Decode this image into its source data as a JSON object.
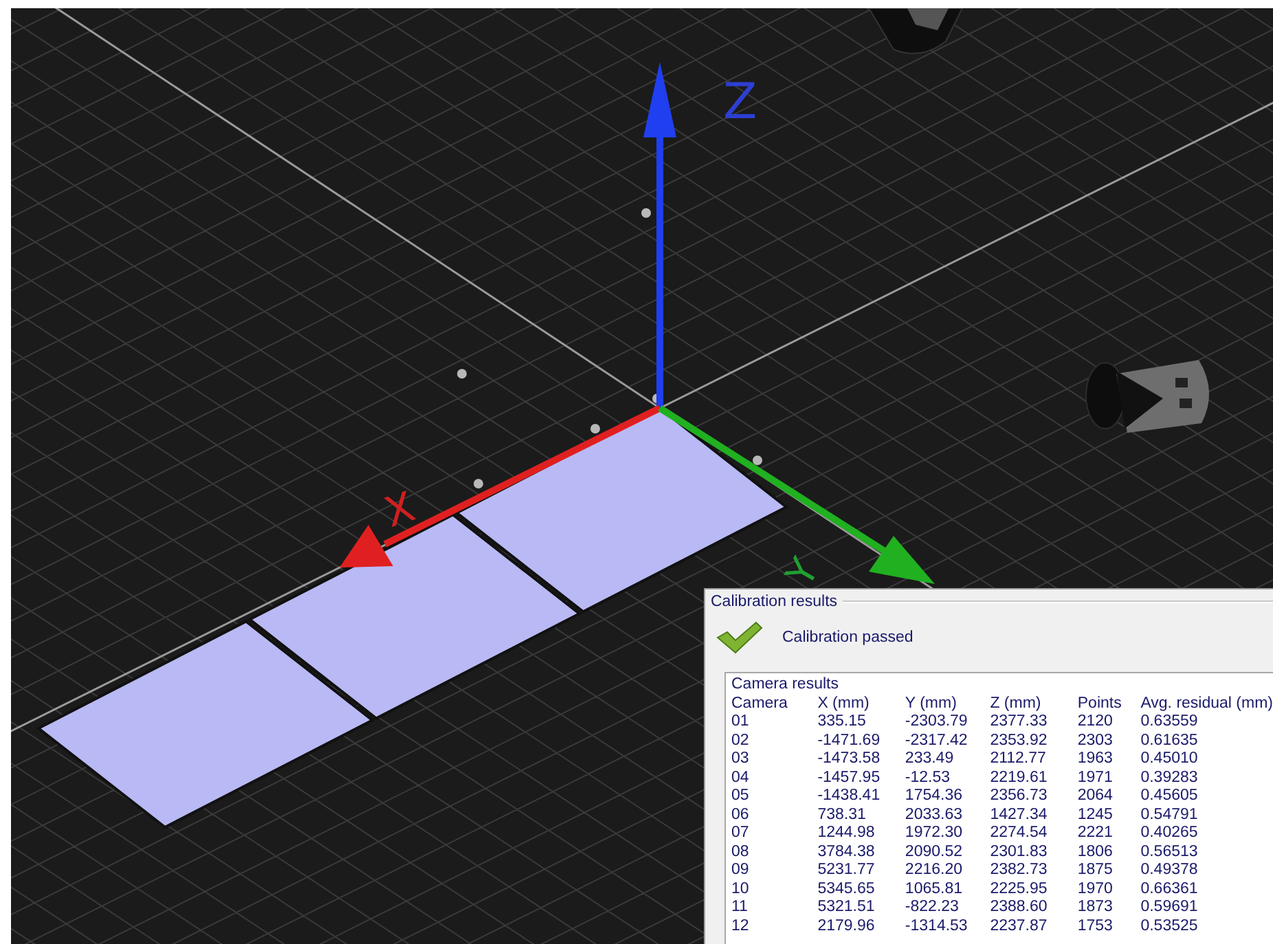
{
  "viewport": {
    "axes": [
      {
        "kind": "z",
        "label": "Z"
      },
      {
        "kind": "x",
        "label": "X"
      },
      {
        "kind": "y",
        "label": "Y"
      }
    ]
  },
  "panel": {
    "title": "Calibration results",
    "status": {
      "text": "Calibration passed",
      "passed": true
    },
    "table": {
      "title": "Camera results",
      "columns": [
        "Camera",
        "X (mm)",
        "Y (mm)",
        "Z (mm)",
        "Points",
        "Avg. residual (mm)"
      ],
      "rows": [
        [
          "01",
          "335.15",
          "-2303.79",
          "2377.33",
          "2120",
          "0.63559"
        ],
        [
          "02",
          "-1471.69",
          "-2317.42",
          "2353.92",
          "2303",
          "0.61635"
        ],
        [
          "03",
          "-1473.58",
          "233.49",
          "2112.77",
          "1963",
          "0.45010"
        ],
        [
          "04",
          "-1457.95",
          "-12.53",
          "2219.61",
          "1971",
          "0.39283"
        ],
        [
          "05",
          "-1438.41",
          "1754.36",
          "2356.73",
          "2064",
          "0.45605"
        ],
        [
          "06",
          "738.31",
          "2033.63",
          "1427.34",
          "1245",
          "0.54791"
        ],
        [
          "07",
          "1244.98",
          "1972.30",
          "2274.54",
          "2221",
          "0.40265"
        ],
        [
          "08",
          "3784.38",
          "2090.52",
          "2301.83",
          "1806",
          "0.56513"
        ],
        [
          "09",
          "5231.77",
          "2216.20",
          "2382.73",
          "1875",
          "0.49378"
        ],
        [
          "10",
          "5345.65",
          "1065.81",
          "2225.95",
          "1970",
          "0.66361"
        ],
        [
          "11",
          "5321.51",
          "-822.23",
          "2388.60",
          "1873",
          "0.59691"
        ],
        [
          "12",
          "2179.96",
          "-1314.53",
          "2237.87",
          "1753",
          "0.53525"
        ]
      ]
    }
  }
}
